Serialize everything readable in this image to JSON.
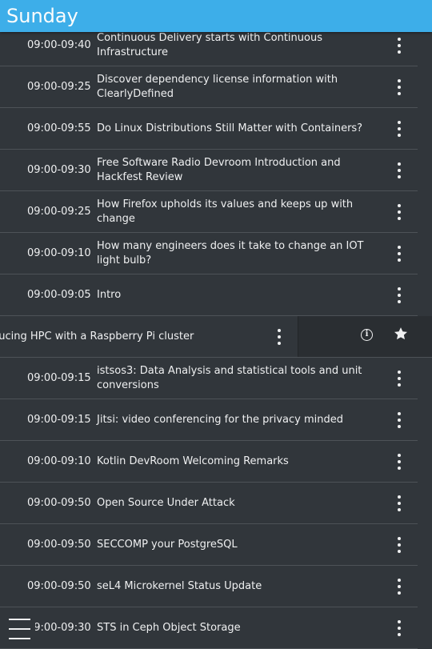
{
  "header": {
    "title": "Sunday"
  },
  "sessions": [
    {
      "time": "09:00-09:40",
      "title": "Continuous Delivery starts with Continuous Infrastructure"
    },
    {
      "time": "09:00-09:25",
      "title": "Discover dependency license information with ClearlyDefined"
    },
    {
      "time": "09:00-09:55",
      "title": "Do Linux Distributions Still Matter with Containers?"
    },
    {
      "time": "09:00-09:30",
      "title": "Free Software Radio Devroom Introduction and Hackfest Review"
    },
    {
      "time": "09:00-09:25",
      "title": "How Firefox upholds its values and keeps up with change"
    },
    {
      "time": "09:00-09:10",
      "title": "How many engineers does it take to change an IOT light bulb?"
    },
    {
      "time": "09:00-09:05",
      "title": "Intro"
    },
    {
      "time": "",
      "title": "ducing HPC with a Raspberry Pi cluster"
    },
    {
      "time": "09:00-09:15",
      "title": "istsos3: Data Analysis and statistical tools and unit conversions"
    },
    {
      "time": "09:00-09:15",
      "title": "Jitsi: video conferencing for the privacy minded"
    },
    {
      "time": "09:00-09:10",
      "title": "Kotlin DevRoom Welcoming Remarks"
    },
    {
      "time": "09:00-09:50",
      "title": "Open Source Under Attack"
    },
    {
      "time": "09:00-09:50",
      "title": "SECCOMP your PostgreSQL"
    },
    {
      "time": "09:00-09:50",
      "title": "seL4 Microkernel Status Update"
    },
    {
      "time": "09:00-09:30",
      "title": "STS in Ceph Object Storage"
    }
  ],
  "swiped_actions": {
    "info_glyph": "i",
    "info_icon": "info-icon",
    "favorite_icon": "star-icon"
  },
  "drawer_icon": "hamburger-menu-icon",
  "colors": {
    "accent": "#3daee9",
    "background": "#31363b",
    "text": "#eff0f1"
  }
}
